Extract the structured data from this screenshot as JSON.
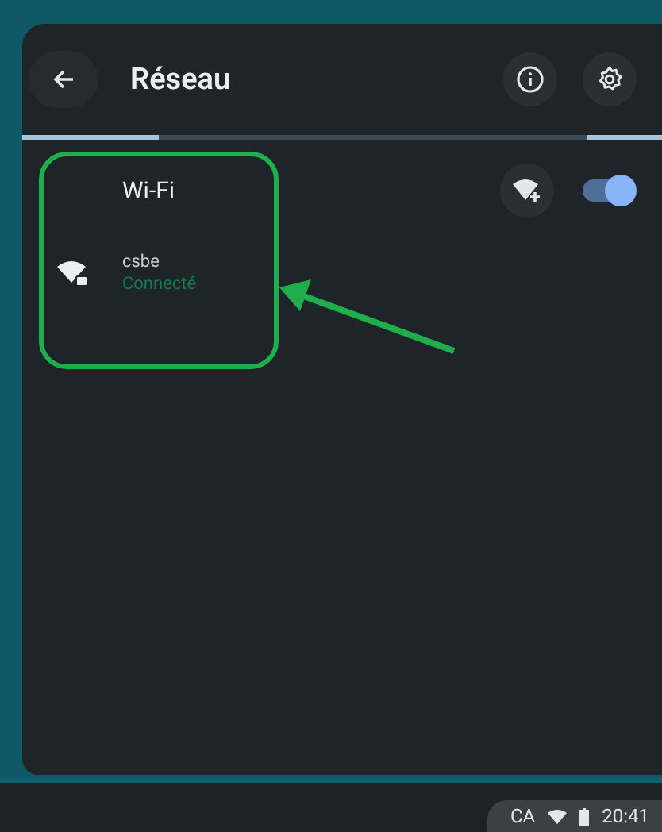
{
  "header": {
    "title": "Réseau"
  },
  "wifi": {
    "label": "Wi-Fi",
    "enabled": true
  },
  "networks": [
    {
      "name": "csbe",
      "status": "Connecté",
      "connected": true
    }
  ],
  "shelf": {
    "locale": "CA",
    "time": "20:41"
  }
}
